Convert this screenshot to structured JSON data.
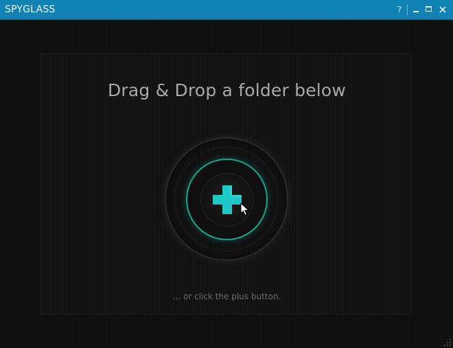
{
  "titlebar": {
    "title": "SPYGLASS",
    "help_label": "?"
  },
  "main": {
    "heading": "Drag & Drop a folder below",
    "hint": "... or click the plus button."
  },
  "icons": {
    "help": "help-icon",
    "minimize": "minimize-icon",
    "maximize": "maximize-icon",
    "close": "close-icon",
    "add": "plus-icon",
    "cursor": "mouse-pointer-icon",
    "resize": "resize-grip-icon"
  },
  "colors": {
    "titlebar": "#1083b4",
    "accent_teal": "#18a58c",
    "plus_cyan": "#1ec8c8",
    "background": "#0f0f0f"
  }
}
